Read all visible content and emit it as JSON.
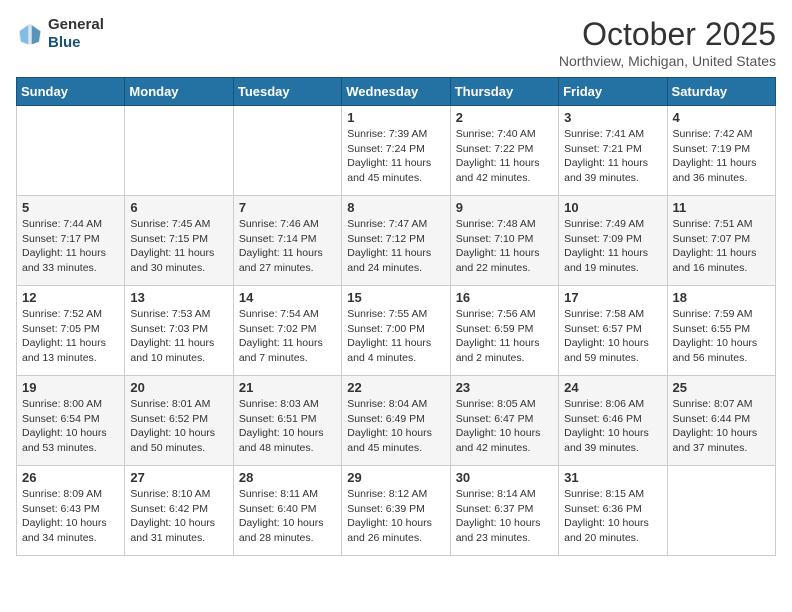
{
  "header": {
    "logo_line1": "General",
    "logo_line2": "Blue",
    "month": "October 2025",
    "location": "Northview, Michigan, United States"
  },
  "weekdays": [
    "Sunday",
    "Monday",
    "Tuesday",
    "Wednesday",
    "Thursday",
    "Friday",
    "Saturday"
  ],
  "weeks": [
    [
      {
        "day": "",
        "sunrise": "",
        "sunset": "",
        "daylight": ""
      },
      {
        "day": "",
        "sunrise": "",
        "sunset": "",
        "daylight": ""
      },
      {
        "day": "",
        "sunrise": "",
        "sunset": "",
        "daylight": ""
      },
      {
        "day": "1",
        "sunrise": "Sunrise: 7:39 AM",
        "sunset": "Sunset: 7:24 PM",
        "daylight": "Daylight: 11 hours and 45 minutes."
      },
      {
        "day": "2",
        "sunrise": "Sunrise: 7:40 AM",
        "sunset": "Sunset: 7:22 PM",
        "daylight": "Daylight: 11 hours and 42 minutes."
      },
      {
        "day": "3",
        "sunrise": "Sunrise: 7:41 AM",
        "sunset": "Sunset: 7:21 PM",
        "daylight": "Daylight: 11 hours and 39 minutes."
      },
      {
        "day": "4",
        "sunrise": "Sunrise: 7:42 AM",
        "sunset": "Sunset: 7:19 PM",
        "daylight": "Daylight: 11 hours and 36 minutes."
      }
    ],
    [
      {
        "day": "5",
        "sunrise": "Sunrise: 7:44 AM",
        "sunset": "Sunset: 7:17 PM",
        "daylight": "Daylight: 11 hours and 33 minutes."
      },
      {
        "day": "6",
        "sunrise": "Sunrise: 7:45 AM",
        "sunset": "Sunset: 7:15 PM",
        "daylight": "Daylight: 11 hours and 30 minutes."
      },
      {
        "day": "7",
        "sunrise": "Sunrise: 7:46 AM",
        "sunset": "Sunset: 7:14 PM",
        "daylight": "Daylight: 11 hours and 27 minutes."
      },
      {
        "day": "8",
        "sunrise": "Sunrise: 7:47 AM",
        "sunset": "Sunset: 7:12 PM",
        "daylight": "Daylight: 11 hours and 24 minutes."
      },
      {
        "day": "9",
        "sunrise": "Sunrise: 7:48 AM",
        "sunset": "Sunset: 7:10 PM",
        "daylight": "Daylight: 11 hours and 22 minutes."
      },
      {
        "day": "10",
        "sunrise": "Sunrise: 7:49 AM",
        "sunset": "Sunset: 7:09 PM",
        "daylight": "Daylight: 11 hours and 19 minutes."
      },
      {
        "day": "11",
        "sunrise": "Sunrise: 7:51 AM",
        "sunset": "Sunset: 7:07 PM",
        "daylight": "Daylight: 11 hours and 16 minutes."
      }
    ],
    [
      {
        "day": "12",
        "sunrise": "Sunrise: 7:52 AM",
        "sunset": "Sunset: 7:05 PM",
        "daylight": "Daylight: 11 hours and 13 minutes."
      },
      {
        "day": "13",
        "sunrise": "Sunrise: 7:53 AM",
        "sunset": "Sunset: 7:03 PM",
        "daylight": "Daylight: 11 hours and 10 minutes."
      },
      {
        "day": "14",
        "sunrise": "Sunrise: 7:54 AM",
        "sunset": "Sunset: 7:02 PM",
        "daylight": "Daylight: 11 hours and 7 minutes."
      },
      {
        "day": "15",
        "sunrise": "Sunrise: 7:55 AM",
        "sunset": "Sunset: 7:00 PM",
        "daylight": "Daylight: 11 hours and 4 minutes."
      },
      {
        "day": "16",
        "sunrise": "Sunrise: 7:56 AM",
        "sunset": "Sunset: 6:59 PM",
        "daylight": "Daylight: 11 hours and 2 minutes."
      },
      {
        "day": "17",
        "sunrise": "Sunrise: 7:58 AM",
        "sunset": "Sunset: 6:57 PM",
        "daylight": "Daylight: 10 hours and 59 minutes."
      },
      {
        "day": "18",
        "sunrise": "Sunrise: 7:59 AM",
        "sunset": "Sunset: 6:55 PM",
        "daylight": "Daylight: 10 hours and 56 minutes."
      }
    ],
    [
      {
        "day": "19",
        "sunrise": "Sunrise: 8:00 AM",
        "sunset": "Sunset: 6:54 PM",
        "daylight": "Daylight: 10 hours and 53 minutes."
      },
      {
        "day": "20",
        "sunrise": "Sunrise: 8:01 AM",
        "sunset": "Sunset: 6:52 PM",
        "daylight": "Daylight: 10 hours and 50 minutes."
      },
      {
        "day": "21",
        "sunrise": "Sunrise: 8:03 AM",
        "sunset": "Sunset: 6:51 PM",
        "daylight": "Daylight: 10 hours and 48 minutes."
      },
      {
        "day": "22",
        "sunrise": "Sunrise: 8:04 AM",
        "sunset": "Sunset: 6:49 PM",
        "daylight": "Daylight: 10 hours and 45 minutes."
      },
      {
        "day": "23",
        "sunrise": "Sunrise: 8:05 AM",
        "sunset": "Sunset: 6:47 PM",
        "daylight": "Daylight: 10 hours and 42 minutes."
      },
      {
        "day": "24",
        "sunrise": "Sunrise: 8:06 AM",
        "sunset": "Sunset: 6:46 PM",
        "daylight": "Daylight: 10 hours and 39 minutes."
      },
      {
        "day": "25",
        "sunrise": "Sunrise: 8:07 AM",
        "sunset": "Sunset: 6:44 PM",
        "daylight": "Daylight: 10 hours and 37 minutes."
      }
    ],
    [
      {
        "day": "26",
        "sunrise": "Sunrise: 8:09 AM",
        "sunset": "Sunset: 6:43 PM",
        "daylight": "Daylight: 10 hours and 34 minutes."
      },
      {
        "day": "27",
        "sunrise": "Sunrise: 8:10 AM",
        "sunset": "Sunset: 6:42 PM",
        "daylight": "Daylight: 10 hours and 31 minutes."
      },
      {
        "day": "28",
        "sunrise": "Sunrise: 8:11 AM",
        "sunset": "Sunset: 6:40 PM",
        "daylight": "Daylight: 10 hours and 28 minutes."
      },
      {
        "day": "29",
        "sunrise": "Sunrise: 8:12 AM",
        "sunset": "Sunset: 6:39 PM",
        "daylight": "Daylight: 10 hours and 26 minutes."
      },
      {
        "day": "30",
        "sunrise": "Sunrise: 8:14 AM",
        "sunset": "Sunset: 6:37 PM",
        "daylight": "Daylight: 10 hours and 23 minutes."
      },
      {
        "day": "31",
        "sunrise": "Sunrise: 8:15 AM",
        "sunset": "Sunset: 6:36 PM",
        "daylight": "Daylight: 10 hours and 20 minutes."
      },
      {
        "day": "",
        "sunrise": "",
        "sunset": "",
        "daylight": ""
      }
    ]
  ]
}
